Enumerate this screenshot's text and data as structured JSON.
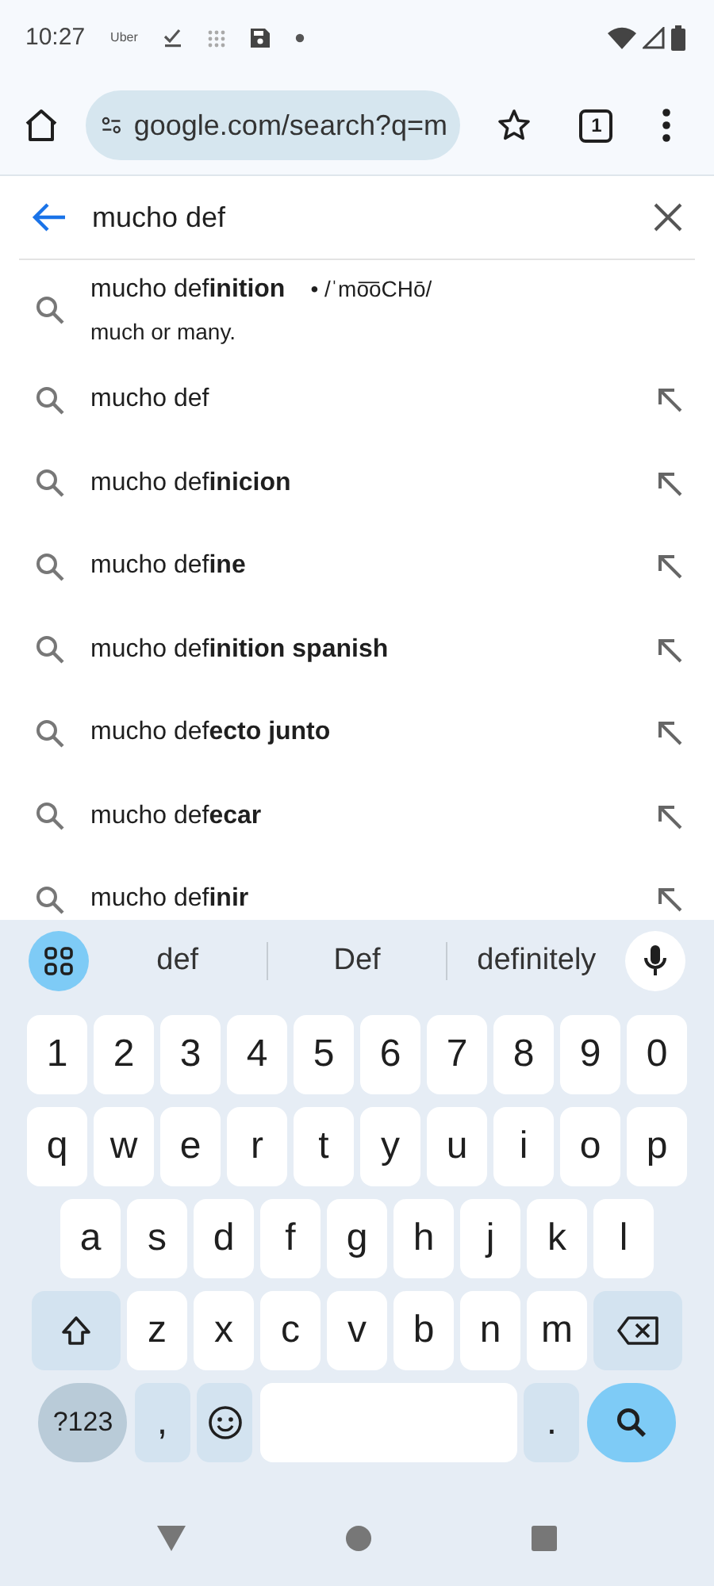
{
  "status_bar": {
    "time": "10:27",
    "app_label": "Uber"
  },
  "toolbar": {
    "url": "google.com/search?q=m",
    "tab_count": "1"
  },
  "search": {
    "value": "mucho def"
  },
  "suggestions": [
    {
      "kind": "definition",
      "text": "mucho def**inition**",
      "pronunciation": "• /ˈmo͞oCHō/",
      "definition": "much or many."
    },
    {
      "kind": "query",
      "text": "mucho def"
    },
    {
      "kind": "query",
      "text": "mucho def**inicion**"
    },
    {
      "kind": "query",
      "text": "mucho def**ine**"
    },
    {
      "kind": "query",
      "text": "mucho def**inition spanish**"
    },
    {
      "kind": "query",
      "text": "mucho def**ecto junto**"
    },
    {
      "kind": "query",
      "text": "mucho def**ecar**"
    },
    {
      "kind": "query",
      "text": "mucho def**inir**"
    }
  ],
  "keyboard": {
    "word_suggestions": [
      "def",
      "Def",
      "definitely"
    ],
    "rows": [
      [
        {
          "kind": "char",
          "label": "1"
        },
        {
          "kind": "char",
          "label": "2"
        },
        {
          "kind": "char",
          "label": "3"
        },
        {
          "kind": "char",
          "label": "4"
        },
        {
          "kind": "char",
          "label": "5"
        },
        {
          "kind": "char",
          "label": "6"
        },
        {
          "kind": "char",
          "label": "7"
        },
        {
          "kind": "char",
          "label": "8"
        },
        {
          "kind": "char",
          "label": "9"
        },
        {
          "kind": "char",
          "label": "0"
        }
      ],
      [
        {
          "kind": "char",
          "label": "q"
        },
        {
          "kind": "char",
          "label": "w"
        },
        {
          "kind": "char",
          "label": "e"
        },
        {
          "kind": "char",
          "label": "r"
        },
        {
          "kind": "char",
          "label": "t"
        },
        {
          "kind": "char",
          "label": "y"
        },
        {
          "kind": "char",
          "label": "u"
        },
        {
          "kind": "char",
          "label": "i"
        },
        {
          "kind": "char",
          "label": "o"
        },
        {
          "kind": "char",
          "label": "p"
        }
      ],
      [
        {
          "kind": "char",
          "label": "a"
        },
        {
          "kind": "char",
          "label": "s"
        },
        {
          "kind": "char",
          "label": "d"
        },
        {
          "kind": "char",
          "label": "f"
        },
        {
          "kind": "char",
          "label": "g"
        },
        {
          "kind": "char",
          "label": "h"
        },
        {
          "kind": "char",
          "label": "j"
        },
        {
          "kind": "char",
          "label": "k"
        },
        {
          "kind": "char",
          "label": "l"
        }
      ],
      [
        {
          "kind": "shift"
        },
        {
          "kind": "char",
          "label": "z"
        },
        {
          "kind": "char",
          "label": "x"
        },
        {
          "kind": "char",
          "label": "c"
        },
        {
          "kind": "char",
          "label": "v"
        },
        {
          "kind": "char",
          "label": "b"
        },
        {
          "kind": "char",
          "label": "n"
        },
        {
          "kind": "char",
          "label": "m"
        },
        {
          "kind": "backspace"
        }
      ],
      [
        {
          "kind": "symbols",
          "label": "?123"
        },
        {
          "kind": "punct",
          "label": ","
        },
        {
          "kind": "emoji"
        },
        {
          "kind": "space"
        },
        {
          "kind": "punct",
          "label": "."
        },
        {
          "kind": "search"
        }
      ]
    ]
  }
}
